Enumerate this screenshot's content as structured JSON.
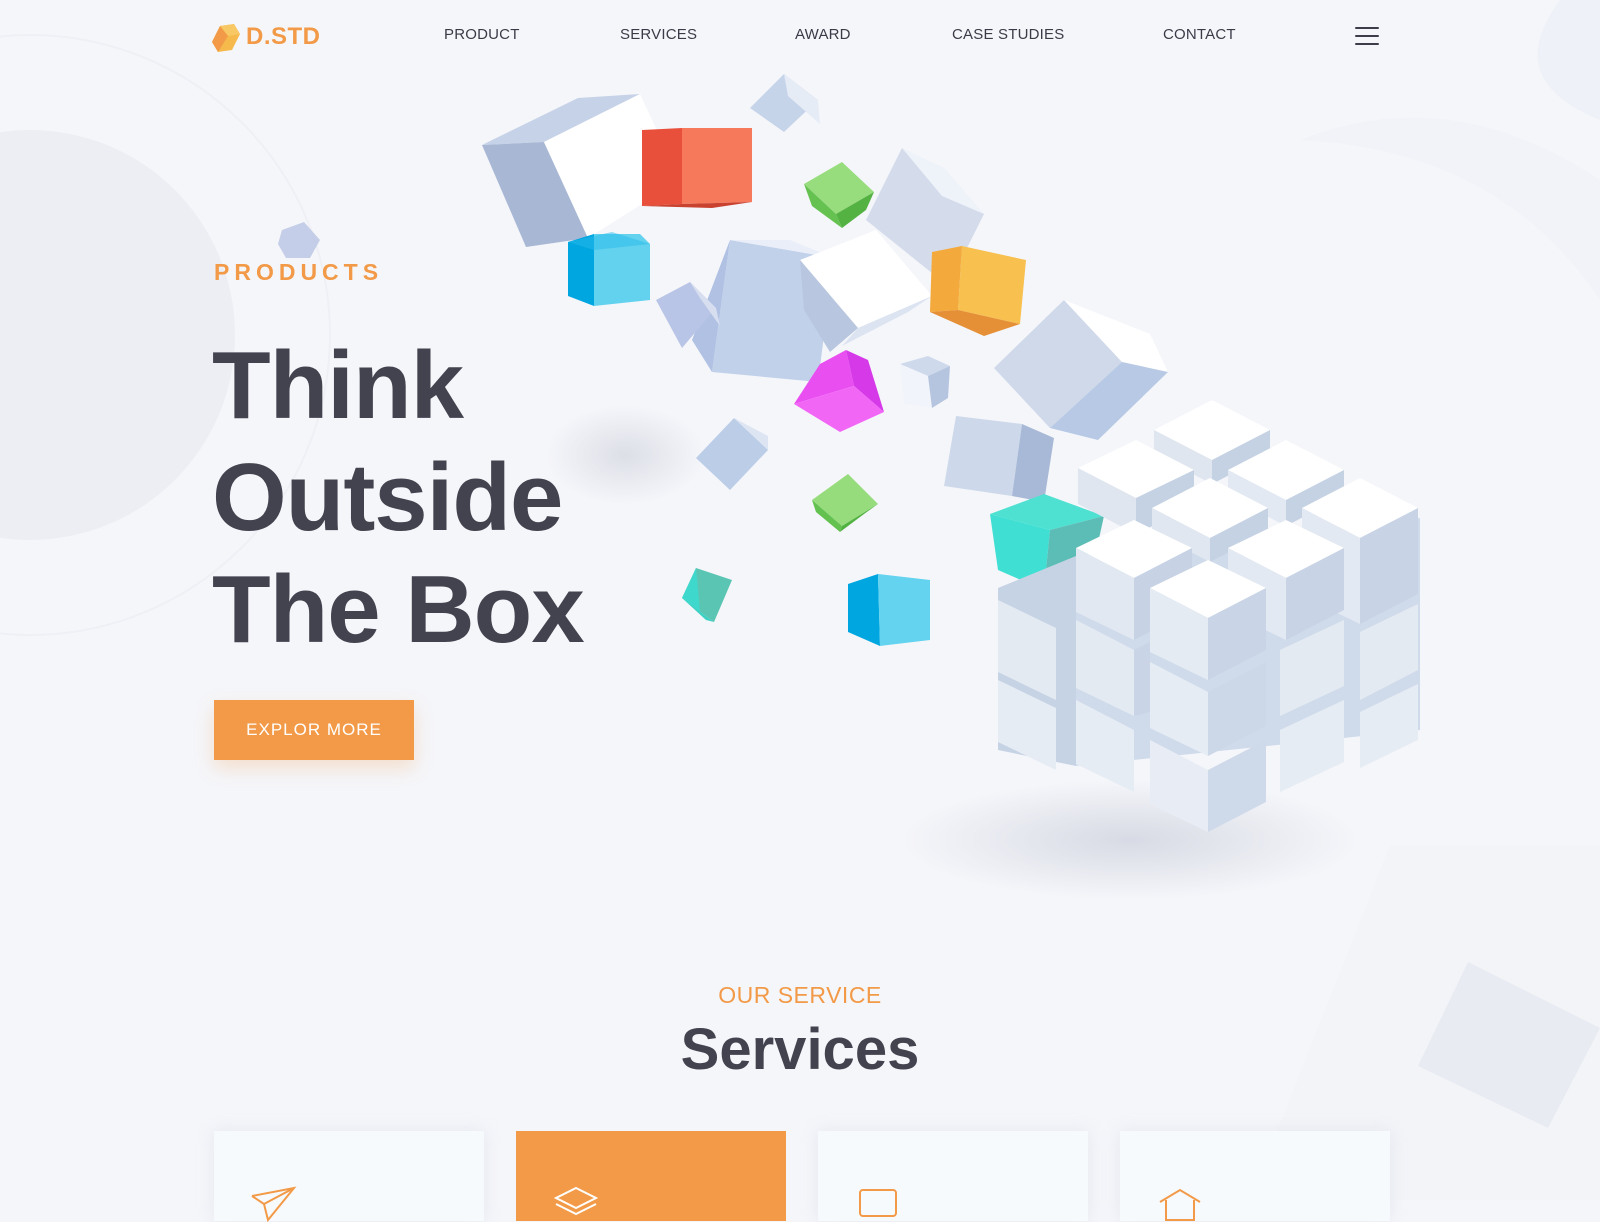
{
  "brand": {
    "logo_text": "D.STD",
    "accent_color": "#f29a47",
    "text_color": "#43434f"
  },
  "nav": {
    "items": [
      {
        "label": "PRODUCT"
      },
      {
        "label": "SERVICES"
      },
      {
        "label": "AWARD"
      },
      {
        "label": "CASE STUDIES"
      },
      {
        "label": "CONTACT"
      }
    ],
    "menu_icon": "hamburger-menu-icon"
  },
  "hero": {
    "eyebrow": "PRODUCTS",
    "title_lines": [
      "Think",
      "Outside",
      "The Box"
    ],
    "cta_label": "EXPLOR MORE"
  },
  "services": {
    "eyebrow": "OUR SERVICE",
    "title": "Services",
    "cards": [
      {
        "icon": "paper-plane-icon",
        "active": false
      },
      {
        "icon": "layers-icon",
        "active": true
      },
      {
        "icon": "monitor-icon",
        "active": false
      },
      {
        "icon": "house-icon",
        "active": false
      }
    ]
  }
}
